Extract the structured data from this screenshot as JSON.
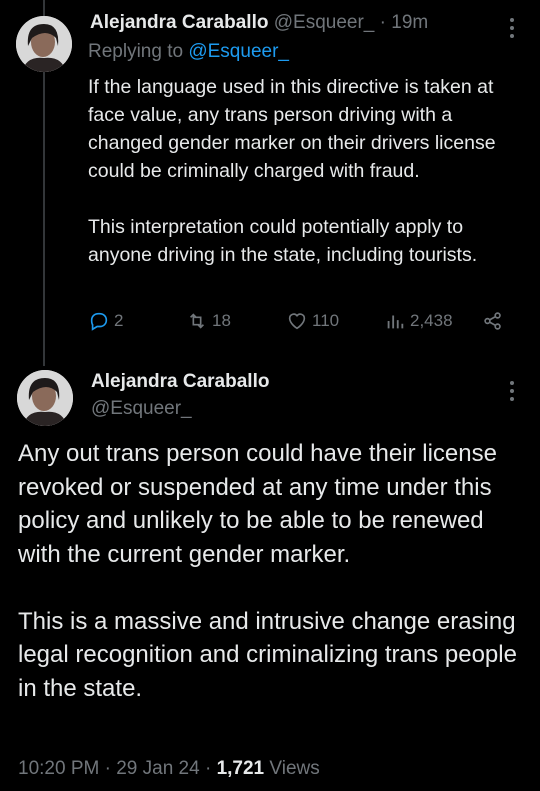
{
  "reply": {
    "author_name": "Alejandra Caraballo",
    "author_handle": "@Esqueer_",
    "time": "· 19m",
    "replying_prefix": "Replying to ",
    "replying_handle": "@Esqueer_",
    "text": "If the language used in this directive is taken at face value, any trans person driving with a changed gender marker on their drivers license could be criminally charged with fraud.\n\nThis interpretation could potentially apply to anyone driving in the state, including tourists.",
    "replies": "2",
    "retweets": "18",
    "likes": "110",
    "views": "2,438"
  },
  "main": {
    "author_name": "Alejandra Caraballo",
    "author_handle": "@Esqueer_",
    "text": "Any out trans person could have their license revoked or suspended at any time under this policy and unlikely to be able to be renewed with the current gender marker.\n\nThis is a massive and intrusive change erasing legal recognition and criminalizing trans people in the state.",
    "time": "10:20 PM",
    "date": "29 Jan 24",
    "views_count": "1,721",
    "views_label": "Views"
  },
  "icons": {
    "reply": "reply-icon",
    "retweet": "retweet-icon",
    "like": "heart-icon",
    "views": "views-chart-icon",
    "share": "share-icon",
    "more": "more-dots-icon"
  },
  "colors": {
    "background": "#000000",
    "text": "#e7e9ea",
    "muted": "#71767b",
    "link": "#1d9bf0"
  }
}
